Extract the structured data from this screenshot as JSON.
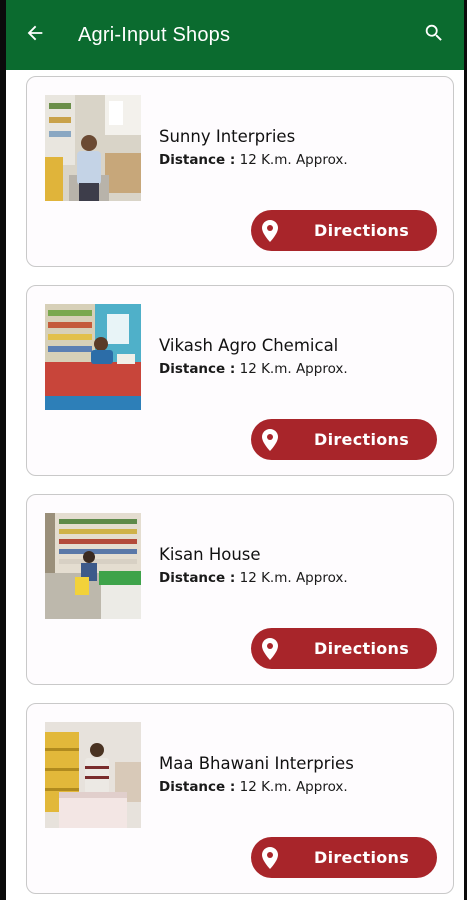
{
  "header": {
    "title": "Agri-Input Shops",
    "back_icon": "arrow-left-icon",
    "search_icon": "search-icon",
    "background": "#0b6b2f"
  },
  "shops": [
    {
      "name": "Sunny Interpries",
      "distance_label": "Distance :",
      "distance_value": " 12 K.m.  Approx.",
      "directions_label": "Directions"
    },
    {
      "name": "Vikash Agro Chemical",
      "distance_label": "Distance :",
      "distance_value": " 12 K.m.  Approx.",
      "directions_label": "Directions"
    },
    {
      "name": "Kisan House",
      "distance_label": "Distance :",
      "distance_value": " 12 K.m.  Approx.",
      "directions_label": "Directions"
    },
    {
      "name": "Maa Bhawani Interpries",
      "distance_label": "Distance :",
      "distance_value": " 12 K.m.  Approx.",
      "directions_label": "Directions"
    }
  ],
  "colors": {
    "accent_button": "#a8252a",
    "card_border": "#c9c9c9"
  }
}
